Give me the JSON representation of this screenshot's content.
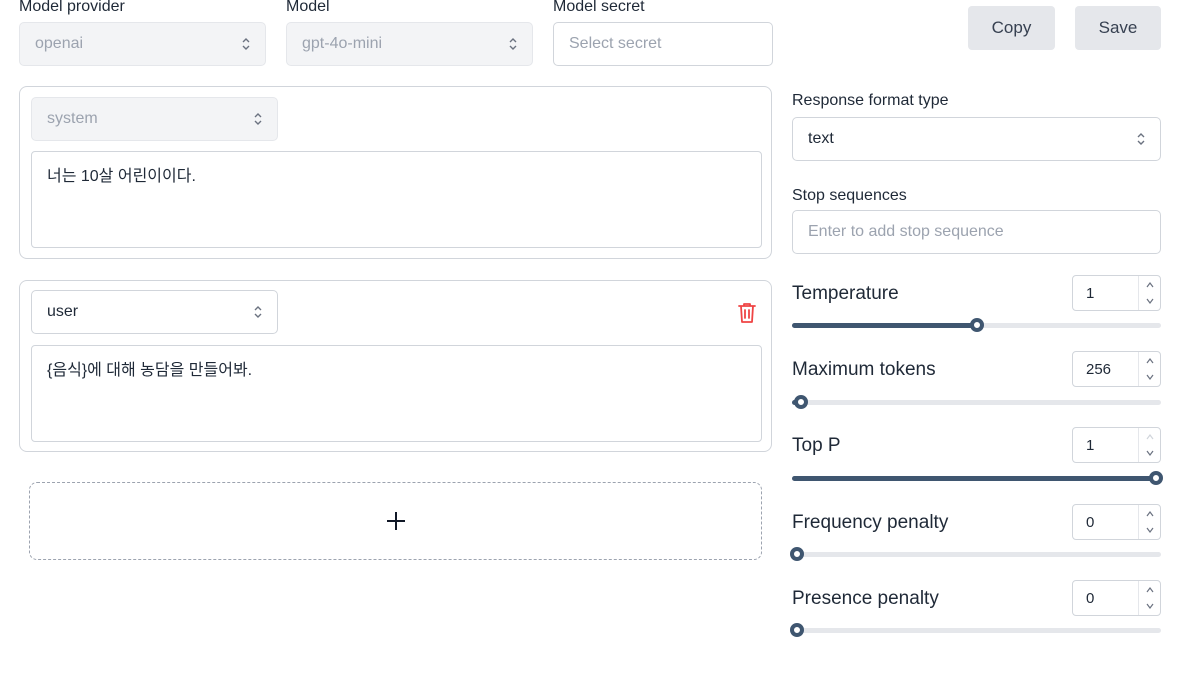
{
  "model_provider": {
    "label": "Model provider",
    "value": "openai"
  },
  "model": {
    "label": "Model",
    "value": "gpt-4o-mini"
  },
  "model_secret": {
    "label": "Model secret",
    "placeholder": "Select secret"
  },
  "buttons": {
    "copy": "Copy",
    "save": "Save"
  },
  "messages": [
    {
      "role": "system",
      "content": "너는 10살 어린이이다."
    },
    {
      "role": "user",
      "content": "{음식}에 대해 농담을 만들어봐."
    }
  ],
  "add_message_symbol": "+",
  "response_format": {
    "label": "Response format type",
    "value": "text"
  },
  "stop_sequences": {
    "label": "Stop sequences",
    "placeholder": "Enter to add stop sequence"
  },
  "params": {
    "temperature": {
      "label": "Temperature",
      "value": "1",
      "fraction": 0.5
    },
    "max_tokens": {
      "label": "Maximum tokens",
      "value": "256",
      "fraction": 0.025
    },
    "top_p": {
      "label": "Top P",
      "value": "1",
      "fraction": 1.0
    },
    "frequency_penalty": {
      "label": "Frequency penalty",
      "value": "0",
      "fraction": 0.0
    },
    "presence_penalty": {
      "label": "Presence penalty",
      "value": "0",
      "fraction": 0.0
    }
  },
  "colors": {
    "accent": "#3f5670",
    "danger": "#ef4444",
    "track": "#e5e7eb"
  }
}
